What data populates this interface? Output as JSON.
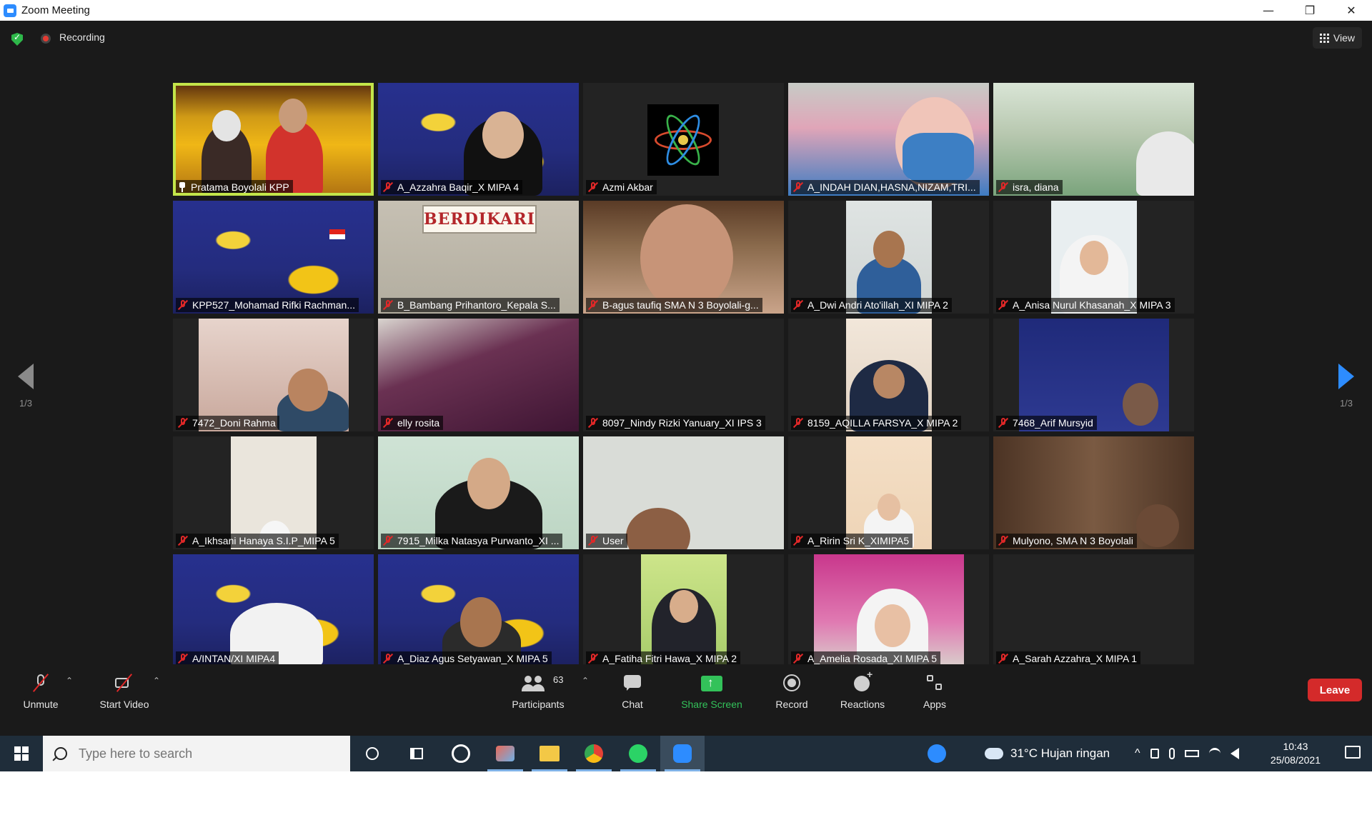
{
  "window": {
    "title": "Zoom Meeting",
    "controls": {
      "minimize": "—",
      "restore": "❐",
      "close": "✕"
    }
  },
  "topbar": {
    "recording_label": "Recording",
    "view_label": "View"
  },
  "pagination": {
    "left_label": "1/3",
    "right_label": "1/3"
  },
  "participants": [
    {
      "name": "Pratama Boyolali KPP",
      "active": true,
      "pinned": true
    },
    {
      "name": "A_Azzahra Baqir_X MIPA 4"
    },
    {
      "name": "Azmi Akbar"
    },
    {
      "name": "A_INDAH DIAN,HASNA,NIZAM,TRI..."
    },
    {
      "name": "isra, diana"
    },
    {
      "name": "KPP527_Mohamad Rifki Rachman..."
    },
    {
      "name": "B_Bambang Prihantoro_Kepala S..."
    },
    {
      "name": "B-agus taufiq SMA N 3 Boyolali-g..."
    },
    {
      "name": "A_Dwi Andri Ato'illah_XI MIPA 2"
    },
    {
      "name": "A_Anisa Nurul Khasanah_X MIPA 3"
    },
    {
      "name": "7472_Doni Rahma"
    },
    {
      "name": "elly rosita"
    },
    {
      "name": "8097_Nindy Rizki Yanuary_XI IPS 3"
    },
    {
      "name": "8159_AQILLA FARSYA_X MIPA 2"
    },
    {
      "name": "7468_Arif Mursyid"
    },
    {
      "name": "A_Ikhsani Hanaya S.I.P_MIPA 5"
    },
    {
      "name": "7915_Milka Natasya Purwanto_XI ..."
    },
    {
      "name": "User"
    },
    {
      "name": "A_Ririn Sri K_XIMIPA5"
    },
    {
      "name": "Mulyono, SMA N 3 Boyolali"
    },
    {
      "name": "A/INTAN/XI MIPA4"
    },
    {
      "name": "A_Diaz Agus Setyawan_X MIPA 5"
    },
    {
      "name": "A_Fatiha Fitri Hawa_X MIPA 2"
    },
    {
      "name": "A_Amelia Rosada_XI MIPA 5"
    },
    {
      "name": "A_Sarah Azzahra_X MIPA 1"
    }
  ],
  "tile_text": {
    "berdikari": "BERDIKARI"
  },
  "toolbar": {
    "unmute": "Unmute",
    "start_video": "Start Video",
    "participants": "Participants",
    "participants_count": "63",
    "chat": "Chat",
    "share_screen": "Share Screen",
    "record": "Record",
    "reactions": "Reactions",
    "apps": "Apps",
    "leave": "Leave",
    "caret": "⌃"
  },
  "taskbar": {
    "search_placeholder": "Type here to search",
    "weather": "31°C  Hujan ringan",
    "time": "10:43",
    "date": "25/08/2021"
  },
  "colors": {
    "accent_green": "#33c25a",
    "active_speaker": "#c3e54a",
    "leave_red": "#d42a2a",
    "zoom_blue": "#2d8cff"
  }
}
